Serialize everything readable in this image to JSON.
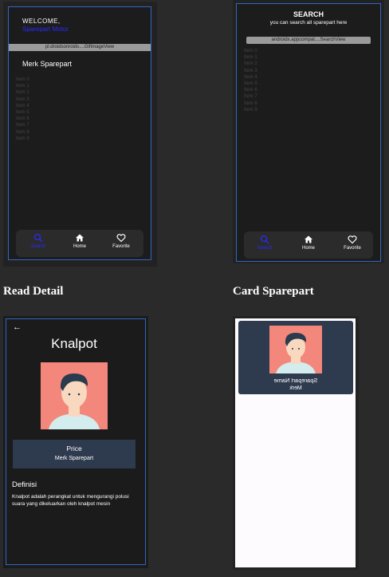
{
  "home": {
    "welcome": "WELCOME,",
    "username": "Sparepart Motor",
    "image_view_label": "pl.droidsonroids....GifImageView",
    "merk_title": "Merk Sparepart",
    "items": [
      "Item 0",
      "Item 1",
      "Item 2",
      "Item 3",
      "Item 4",
      "Item 5",
      "Item 6",
      "Item 7",
      "Item 8",
      "Item 9"
    ]
  },
  "search": {
    "title": "SEARCH",
    "subtitle": "you can search all sparepart here",
    "search_view_label": "androidx.appcompat....SearchView",
    "items": [
      "Item 0",
      "Item 1",
      "Item 2",
      "Item 3",
      "Item 4",
      "Item 5",
      "Item 6",
      "Item 7",
      "Item 8",
      "Item 9"
    ]
  },
  "nav": {
    "search_label": "Search",
    "home_label": "Home",
    "favorite_label": "Favorite"
  },
  "captions": {
    "read_detail": "Read Detail",
    "card_sparepart": "Card Sparepart"
  },
  "detail": {
    "title": "Knalpot",
    "price_label": "Price",
    "merk_label": "Merk Sparepart",
    "definisi_title": "Definisi",
    "definisi_text": "Knalpot adalah perangkat untuk mengurangi polusi suara yang dikeluarkan oleh knalpot mesin"
  },
  "card": {
    "name": "Sparepart Name",
    "merk": "Merk"
  },
  "colors": {
    "accent_blue": "#2f66c4",
    "active_nav": "#2a2aff",
    "avatar_bg": "#f4877b",
    "price_box": "#2e3a4e"
  }
}
